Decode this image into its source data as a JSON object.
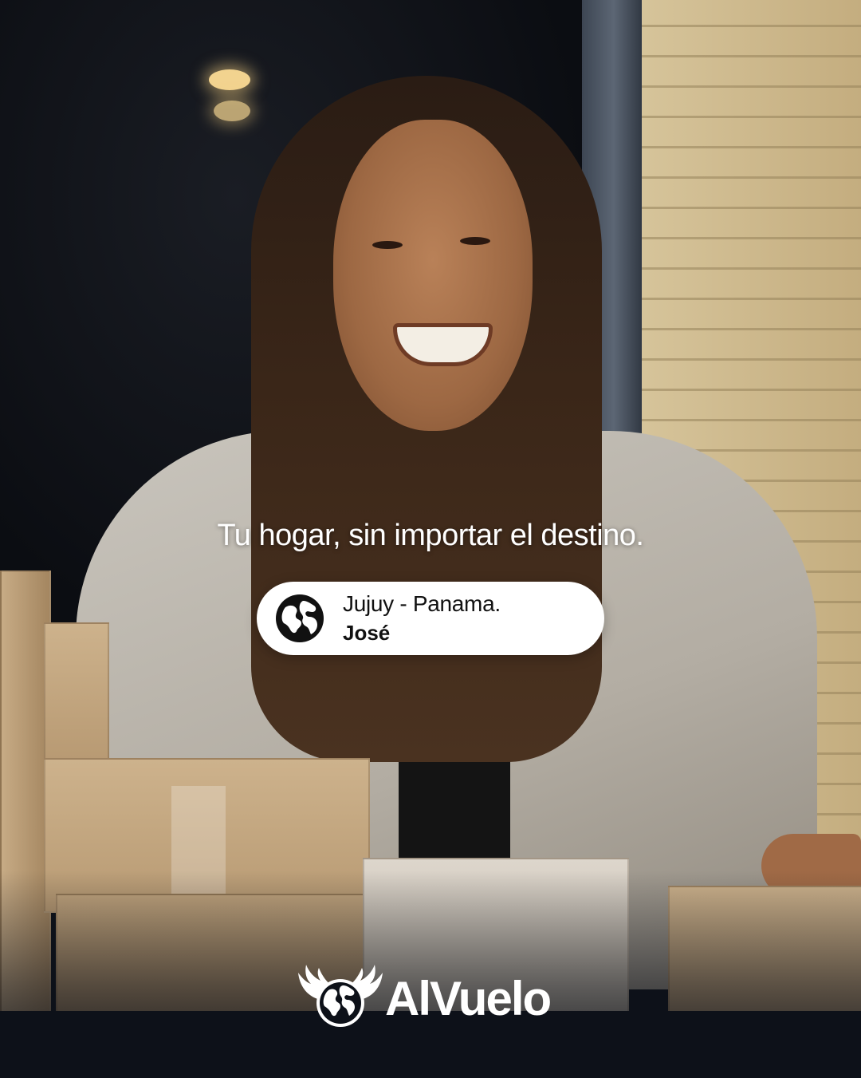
{
  "post": {
    "tagline": "Tu hogar, sin importar el destino.",
    "testimonial": {
      "route": "Jujuy - Panama.",
      "name": "José",
      "icon": "globe-icon"
    },
    "brand": {
      "name": "AlVuelo",
      "logo_icon": "winged-globe-icon"
    }
  },
  "photo": {
    "subject": "smiling man with long hair and cardboard boxes"
  },
  "colors": {
    "text_light": "#ffffff",
    "pill_background": "#ffffff",
    "text_dark": "#111111",
    "footer_background": "#0d1119"
  }
}
